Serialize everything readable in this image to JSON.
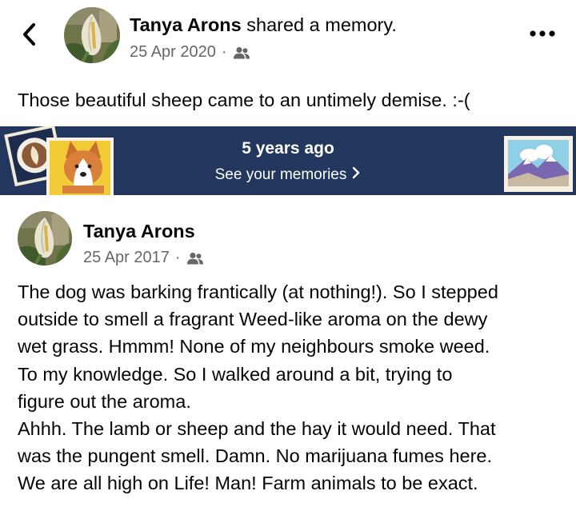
{
  "header": {
    "author": "Tanya Arons",
    "action": "shared a memory.",
    "date": "25 Apr 2020",
    "separator": "·",
    "audience_icon": "friends-icon",
    "back_icon": "chevron-left-icon",
    "more_icon": "more-horizontal-icon"
  },
  "shared_caption": "Those beautiful sheep came to an untimely demise.  :-(",
  "memory_banner": {
    "title": "5 years ago",
    "link_label": "See your memories",
    "link_chevron": "›",
    "background_color": "#23375e"
  },
  "original_post": {
    "author": "Tanya Arons",
    "date": "25 Apr 2017",
    "separator": "·",
    "audience_icon": "friends-icon",
    "body_lines": [
      "The dog was barking frantically (at nothing!). So I stepped",
      "outside to smell a fragrant Weed-like aroma on the dewy",
      "wet grass.  Hmmm!  None of my neighbours smoke weed.",
      "To my knowledge.  So I walked around a bit, trying to",
      "figure out the aroma.",
      "Ahhh. The lamb or sheep and the hay it would need.  That",
      "was the pungent smell.  Damn.  No marijuana fumes here.",
      "We are all high on Life! Man!  Farm animals to be exact."
    ]
  },
  "colors": {
    "text": "#050505",
    "secondary_text": "#65676b",
    "banner": "#23375e"
  }
}
